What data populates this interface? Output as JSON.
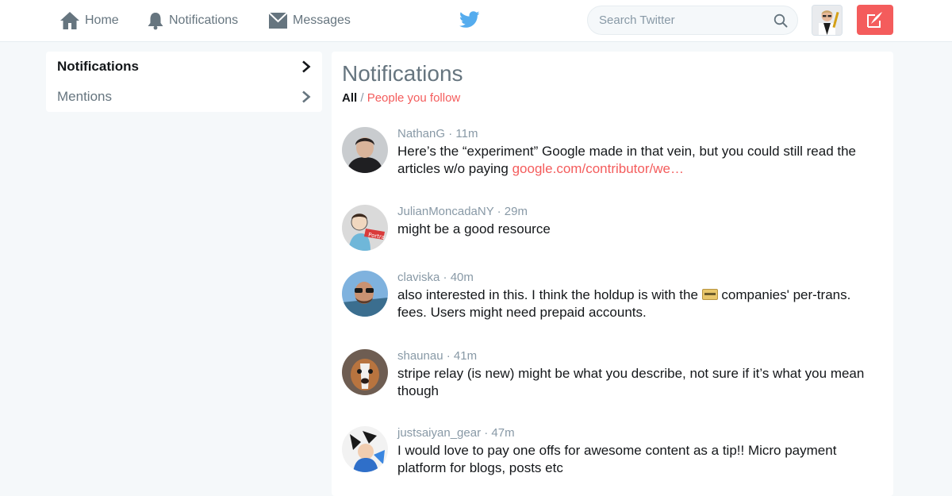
{
  "nav": {
    "home": "Home",
    "notifications": "Notifications",
    "messages": "Messages"
  },
  "search": {
    "placeholder": "Search Twitter"
  },
  "side_menu": {
    "items": [
      {
        "label": "Notifications",
        "active": true
      },
      {
        "label": "Mentions",
        "active": false
      }
    ]
  },
  "main": {
    "title": "Notifications",
    "filter_all": "All",
    "filter_sep": " / ",
    "filter_follow": "People you follow"
  },
  "notifications": [
    {
      "user": "NathanG",
      "time": " · 11m",
      "text": "Here’s the “experiment” Google made in that vein, but you could still read the articles w/o paying ",
      "link": "google.com/contributor/we…"
    },
    {
      "user": "JulianMoncadaNY",
      "time": " · 29m",
      "text": "might be a good resource"
    },
    {
      "user": "claviska",
      "time": " · 40m",
      "text_before": "also interested in this. I think the holdup is with the ",
      "text_after": " companies' per-trans. fees. Users might need prepaid accounts."
    },
    {
      "user": "shaunau",
      "time": " · 41m",
      "text": "stripe relay (is new) might be what you describe, not sure if it’s what you mean though"
    },
    {
      "user": "justsaiyan_gear",
      "time": " · 47m",
      "text": "I would love to pay one offs for awesome content as a tip!! Micro payment platform for blogs, posts etc"
    }
  ],
  "colors": {
    "accent": "#F45C5C",
    "brand_blue": "#55ACEE",
    "muted": "#8899A6"
  },
  "icons": {
    "home": "home-icon",
    "notifications": "bell-icon",
    "messages": "envelope-icon",
    "logo": "twitter-bird-icon",
    "search": "search-icon",
    "compose": "compose-icon",
    "chevron": "chevron-right-icon"
  }
}
